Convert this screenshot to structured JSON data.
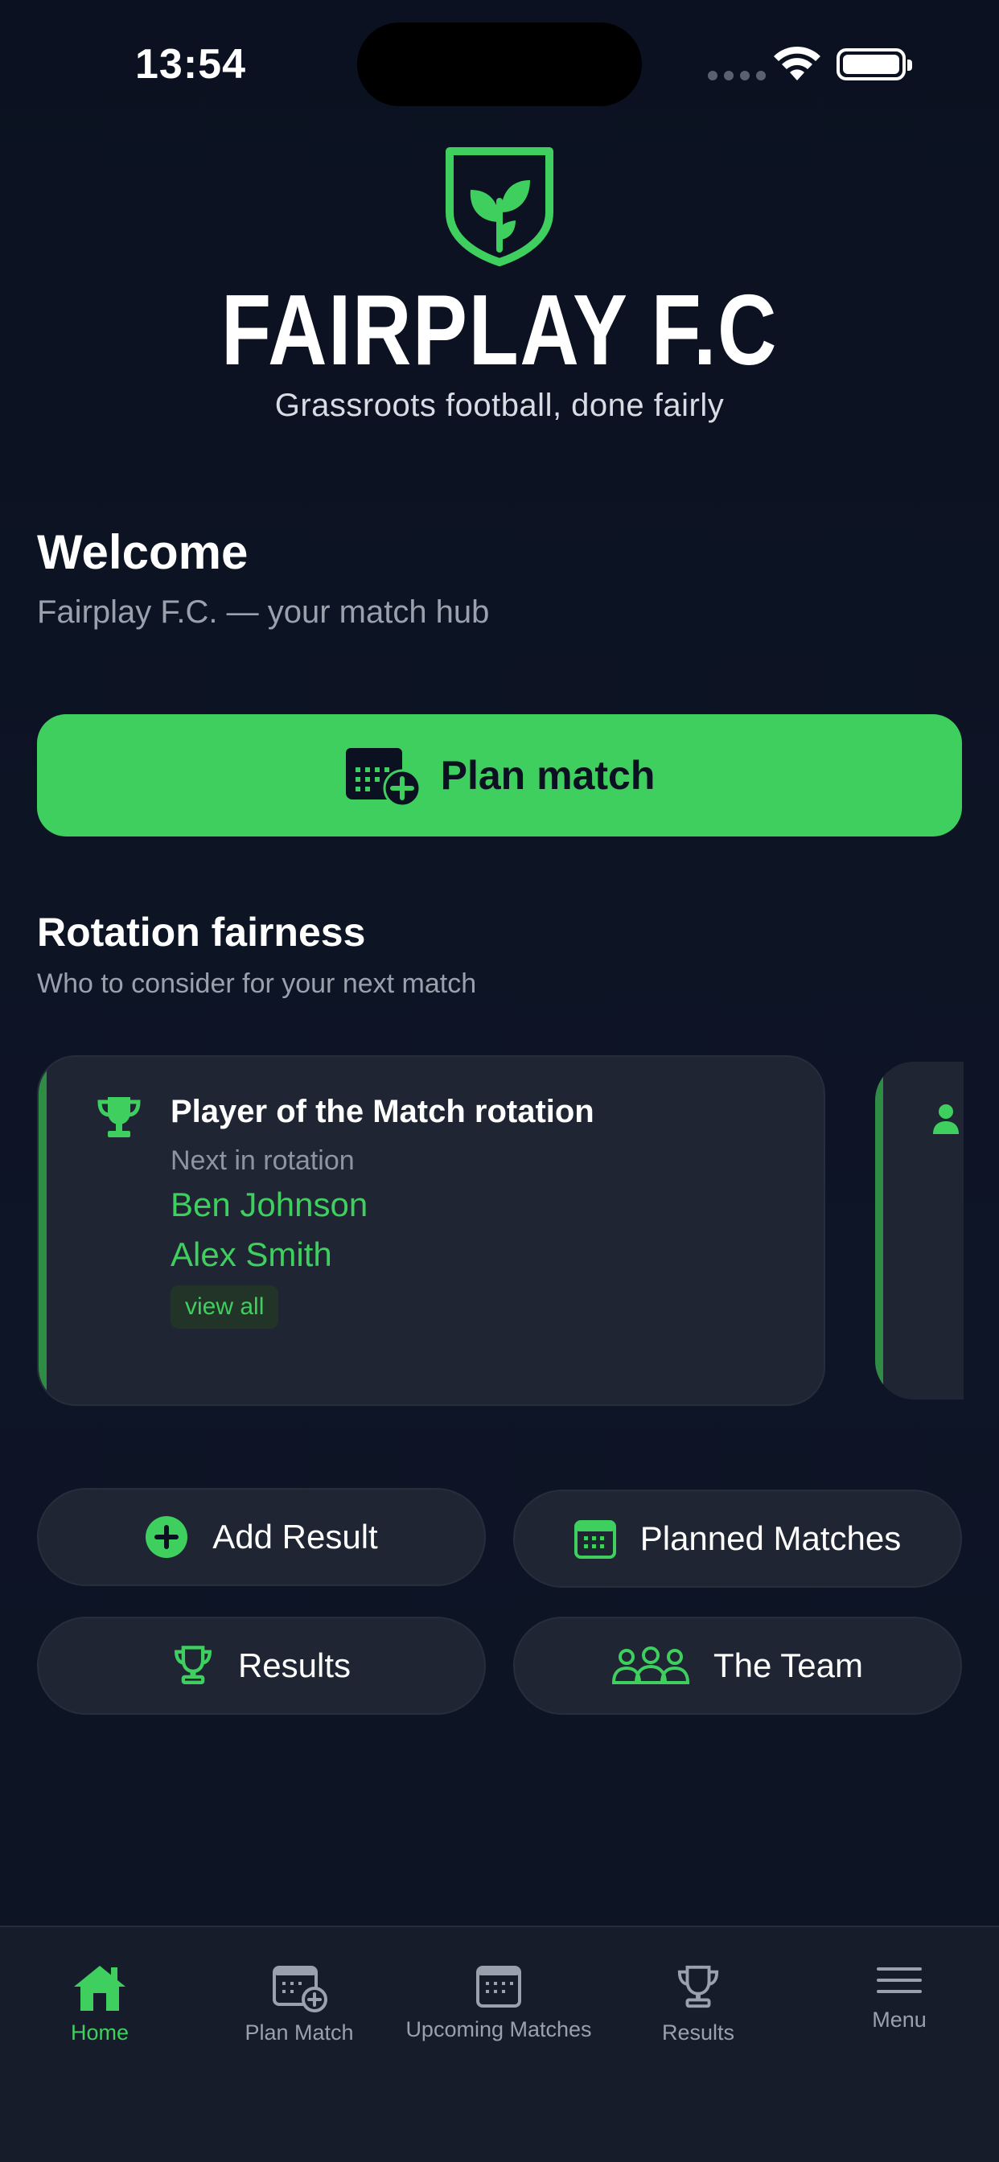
{
  "status_bar": {
    "time": "13:54"
  },
  "brand": {
    "title": "FAIRPLAY F.C",
    "tagline": "Grassroots football, done fairly"
  },
  "welcome": {
    "heading": "Welcome",
    "subtitle": "Fairplay F.C. — your match hub"
  },
  "plan_match": {
    "label": "Plan match"
  },
  "rotation": {
    "title": "Rotation fairness",
    "subtitle": "Who to consider for your next match",
    "cards": [
      {
        "title": "Player of the Match rotation",
        "next_label": "Next in rotation",
        "players": [
          "Ben Johnson",
          "Alex Smith"
        ],
        "view_all": "view all"
      }
    ]
  },
  "actions": [
    {
      "label": "Add Result",
      "icon": "plus-circle-icon"
    },
    {
      "label": "Planned Matches",
      "icon": "calendar-icon"
    },
    {
      "label": "Results",
      "icon": "trophy-icon"
    },
    {
      "label": "The Team",
      "icon": "team-icon"
    }
  ],
  "tabbar": {
    "items": [
      {
        "label": "Home",
        "icon": "home-icon",
        "active": true
      },
      {
        "label": "Plan Match",
        "icon": "calendar-plus-icon"
      },
      {
        "label": "Upcoming Matches",
        "icon": "calendar-icon"
      },
      {
        "label": "Results",
        "icon": "trophy-icon"
      },
      {
        "label": "Menu",
        "icon": "hamburger-icon"
      }
    ]
  },
  "colors": {
    "accent": "#3ecf5f",
    "background": "#0b1120",
    "card": "#1f2533",
    "muted_text": "#9aa1ad"
  }
}
